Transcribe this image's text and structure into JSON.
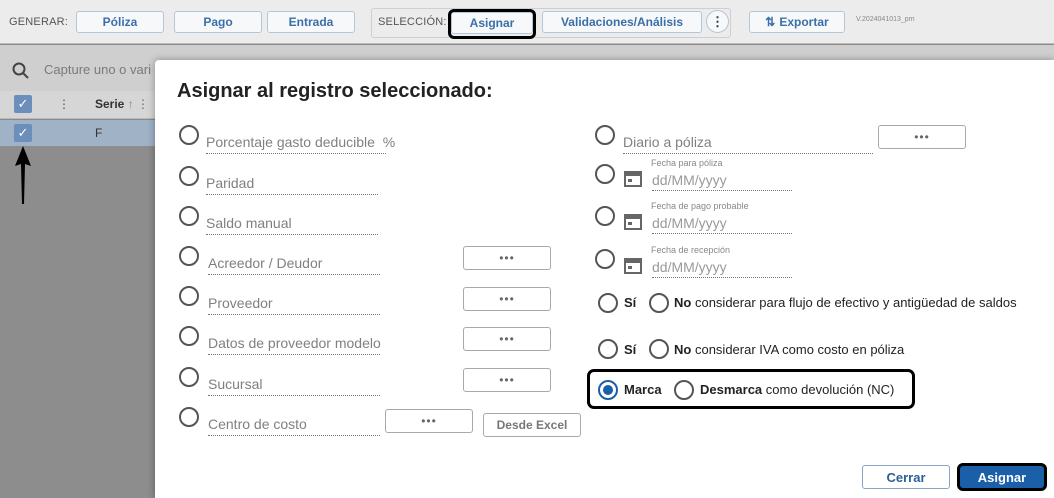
{
  "toolbar": {
    "generar_label": "GENERAR:",
    "poliza": "Póliza",
    "pago": "Pago",
    "entrada": "Entrada",
    "seleccion_label": "SELECCIÓN:",
    "asignar": "Asignar",
    "validaciones": "Validaciones/Análisis",
    "exportar": "Exportar",
    "version": "V.2024041013_pm"
  },
  "search": {
    "placeholder": "Capture uno o vari"
  },
  "grid": {
    "column": "Serie",
    "cell": "F"
  },
  "modal": {
    "title": "Asignar al registro seleccionado:",
    "left_fields": [
      {
        "label": "Porcentaje gasto deducible",
        "suffix": "%"
      },
      {
        "label": "Paridad"
      },
      {
        "label": "Saldo manual"
      },
      {
        "label": "Acreedor / Deudor",
        "button": "•••"
      },
      {
        "label": "Proveedor",
        "button": "•••"
      },
      {
        "label": "Datos de proveedor modelo",
        "button": "•••"
      },
      {
        "label": "Sucursal",
        "button": "•••"
      },
      {
        "label": "Centro de costo",
        "button": "•••"
      }
    ],
    "desde_excel": "Desde Excel",
    "right_fields": {
      "diario": "Diario a póliza",
      "diario_button": "•••",
      "fecha_poliza_caption": "Fecha para póliza",
      "fecha_pago_caption": "Fecha de pago probable",
      "fecha_recepcion_caption": "Fecha de recepción",
      "date_placeholder": "dd/MM/yyyy"
    },
    "options": {
      "si": "Sí",
      "no": "No",
      "flujo_text": "considerar para flujo de efectivo y antigüedad de saldos",
      "iva_text": "considerar IVA como costo en póliza",
      "marca": "Marca",
      "desmarca": "Desmarca",
      "devolucion_text": "como devolución (NC)"
    },
    "cerrar": "Cerrar",
    "asignar": "Asignar"
  },
  "colors": {
    "accent": "#1a5fa8",
    "highlight": "#000000"
  }
}
